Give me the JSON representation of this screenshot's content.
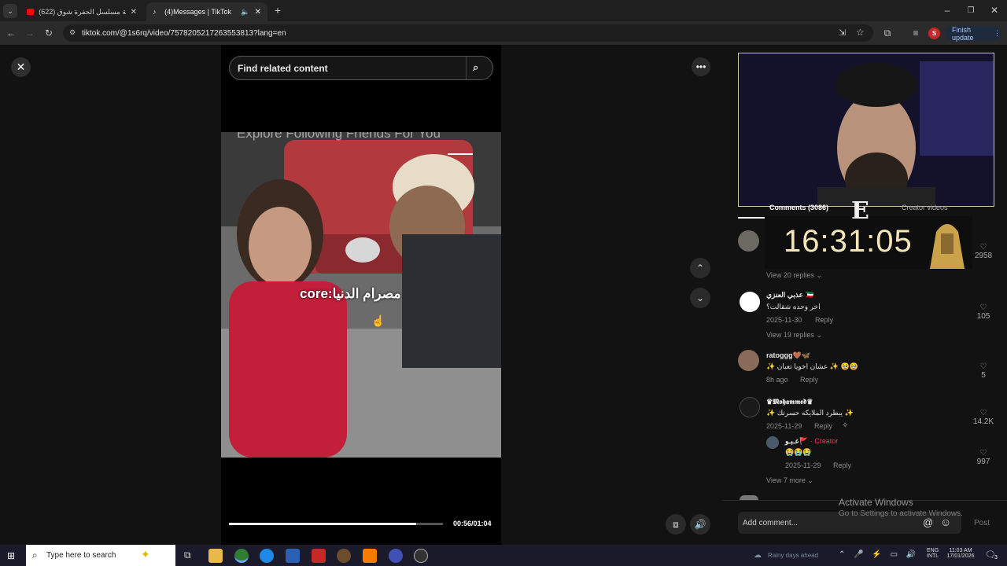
{
  "browser": {
    "tabs": [
      {
        "title": "(622) اغنية مسلسل الحفرة شوق",
        "active": false
      },
      {
        "title": "(4)Messages | TikTok",
        "active": true
      }
    ],
    "url": "tiktok.com/@1s6rq/video/7578205217263553813?lang=en",
    "profile_initial": "S",
    "finish_update": "Finish update"
  },
  "video": {
    "search_placeholder": "Find related content",
    "overlay_tabs": "Explore  Following  Friends  For You",
    "caption": "core:مصرام الدنيا",
    "time": "00:56/01:04",
    "progress": 0.875
  },
  "panel": {
    "tab_comments": "Comments (3086)",
    "tab_creator": "Creator videos",
    "clock": "16:31:05",
    "first_like": "2958",
    "view_20": "View 20 replies",
    "comments": [
      {
        "name": "عذبي العنزي 🇰🇼",
        "text": "اخر وحده شقالت؟",
        "date": "2025-11-30",
        "reply": "Reply",
        "likes": "105",
        "view": "View 19 replies"
      },
      {
        "name": "ratoggg🤎🦋",
        "text": "✨ عشان اخويا تعبان ✨ 🥹🥹",
        "date": "8h ago",
        "reply": "Reply",
        "likes": "5"
      },
      {
        "name": "♛𝕸𝖔𝖍𝖆𝖒𝖒𝖊𝖉♛",
        "text": "✨ يبطرد الملايكه حسرتك ✨",
        "date": "2025-11-29",
        "reply": "Reply",
        "likes": "14.2K"
      },
      {
        "name": "عـبـو🚩",
        "creator": "· Creator",
        "text": "😭😭😭",
        "date": "2025-11-29",
        "reply": "Reply",
        "likes": "997"
      }
    ],
    "view_7": "View 7 more",
    "add_comment": "Add comment...",
    "post": "Post"
  },
  "watermark": {
    "line1": "Activate Windows",
    "line2": "Go to Settings to activate Windows."
  },
  "taskbar": {
    "search": "Type here to search",
    "weather": "Rainy days ahead",
    "lang1": "ENG",
    "lang2": "INTL",
    "time": "11:03 AM",
    "date": "17/01/2026",
    "notif": "3"
  },
  "colors": {
    "creator": "#fe2c55",
    "finish": "#a8c7fa"
  }
}
